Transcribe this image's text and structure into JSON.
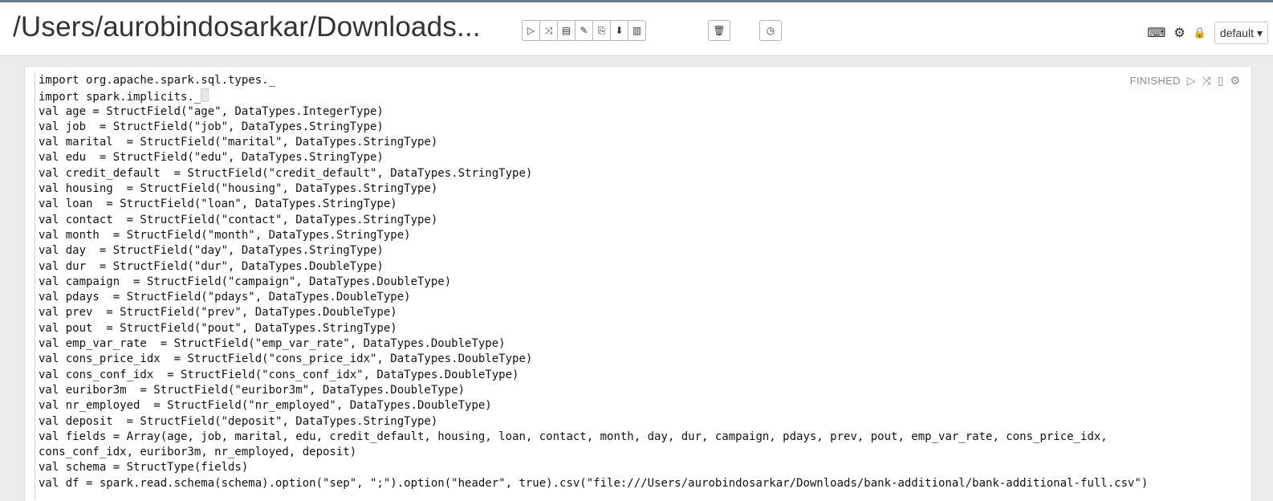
{
  "notebook": {
    "title": "/Users/aurobindosarkar/Downloads..."
  },
  "toolbar": {
    "run_all": {
      "glyph": "▷",
      "icon": "run-all-icon"
    },
    "hide_code": {
      "glyph": "⤨",
      "icon": "show-hide-code-icon"
    },
    "hide_output": {
      "glyph": "▤",
      "icon": "show-hide-output-icon"
    },
    "clear_output": {
      "glyph": "✎",
      "icon": "clear-output-icon"
    },
    "clone": {
      "glyph": "⎘",
      "icon": "clone-icon"
    },
    "export": {
      "glyph": "⬇",
      "icon": "export-icon"
    },
    "version": {
      "glyph": "▥",
      "icon": "version-control-icon"
    },
    "trash": {
      "glyph": "🗑",
      "icon": "trash-icon"
    },
    "scheduler": {
      "glyph": "◷",
      "icon": "clock-icon"
    }
  },
  "right_tools": {
    "keyboard": {
      "glyph": "⌨",
      "icon": "keyboard-icon"
    },
    "settings": {
      "glyph": "⚙",
      "icon": "gear-icon"
    },
    "lock": {
      "glyph": "🔒",
      "icon": "lock-icon"
    },
    "interpreter_select": "default",
    "caret": "▾"
  },
  "paragraph": {
    "status": "FINISHED",
    "run_glyph": "▷",
    "expand_glyph": "⤨",
    "output_glyph": "▯",
    "settings_glyph": "⚙",
    "code_lines": [
      "import org.apache.spark.sql.types._",
      "import spark.implicits._",
      "val age = StructField(\"age\", DataTypes.IntegerType)",
      "val job  = StructField(\"job\", DataTypes.StringType)",
      "val marital  = StructField(\"marital\", DataTypes.StringType)",
      "val edu  = StructField(\"edu\", DataTypes.StringType)",
      "val credit_default  = StructField(\"credit_default\", DataTypes.StringType)",
      "val housing  = StructField(\"housing\", DataTypes.StringType)",
      "val loan  = StructField(\"loan\", DataTypes.StringType)",
      "val contact  = StructField(\"contact\", DataTypes.StringType)",
      "val month  = StructField(\"month\", DataTypes.StringType)",
      "val day  = StructField(\"day\", DataTypes.StringType)",
      "val dur  = StructField(\"dur\", DataTypes.DoubleType)",
      "val campaign  = StructField(\"campaign\", DataTypes.DoubleType)",
      "val pdays  = StructField(\"pdays\", DataTypes.DoubleType)",
      "val prev  = StructField(\"prev\", DataTypes.DoubleType)",
      "val pout  = StructField(\"pout\", DataTypes.StringType)",
      "val emp_var_rate  = StructField(\"emp_var_rate\", DataTypes.DoubleType)",
      "val cons_price_idx  = StructField(\"cons_price_idx\", DataTypes.DoubleType)",
      "val cons_conf_idx  = StructField(\"cons_conf_idx\", DataTypes.DoubleType)",
      "val euribor3m  = StructField(\"euribor3m\", DataTypes.DoubleType)",
      "val nr_employed  = StructField(\"nr_employed\", DataTypes.DoubleType)",
      "val deposit  = StructField(\"deposit\", DataTypes.StringType)",
      "val fields = Array(age, job, marital, edu, credit_default, housing, loan, contact, month, day, dur, campaign, pdays, prev, pout, emp_var_rate, cons_price_idx,",
      "cons_conf_idx, euribor3m, nr_employed, deposit)",
      "val schema = StructType(fields)",
      "val df = spark.read.schema(schema).option(\"sep\", \";\").option(\"header\", true).csv(\"file:///Users/aurobindosarkar/Downloads/bank-additional/bank-additional-full.csv\")"
    ]
  }
}
